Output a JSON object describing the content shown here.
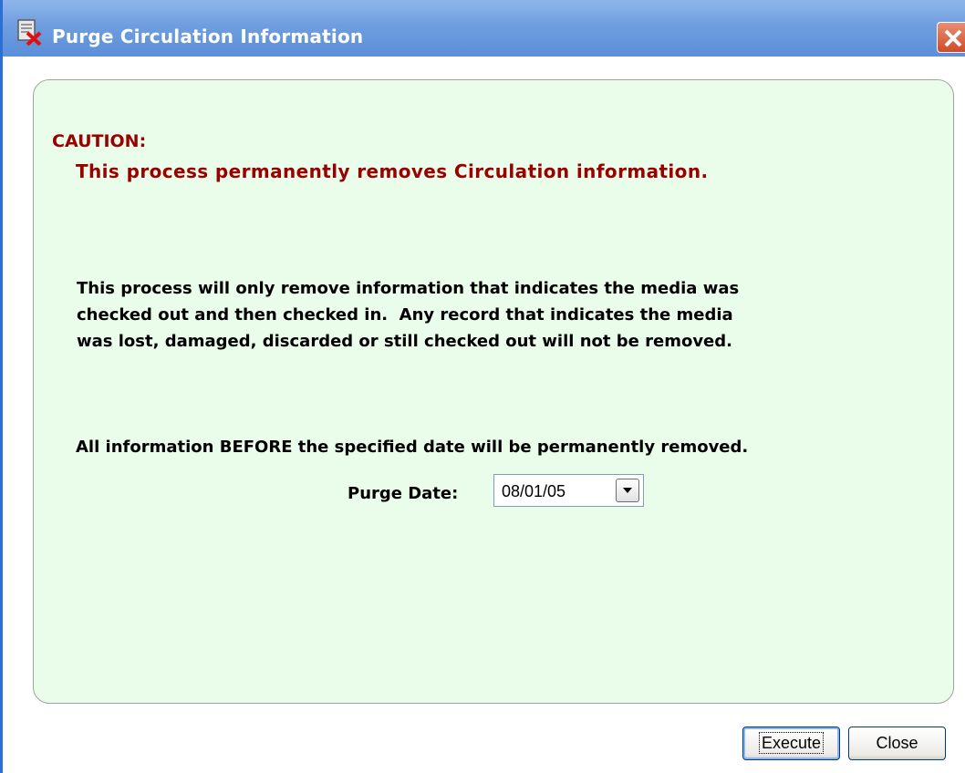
{
  "window": {
    "title": "Purge Circulation Information",
    "icons": {
      "app": "purge-document-icon",
      "close": "close-x-icon"
    }
  },
  "caution": {
    "heading": "CAUTION:",
    "message": "This process permanently removes Circulation information."
  },
  "info": {
    "lines": [
      "This process will only remove information that indicates the media was",
      "checked out and then checked in.  Any record that indicates the media",
      "was lost, damaged, discarded or still checked out will not be removed."
    ]
  },
  "before_note": "All information BEFORE the specified date will be permanently removed.",
  "purge_date": {
    "label": "Purge Date:",
    "value": "08/01/05",
    "dropdown_icon": "dropdown-arrow-icon"
  },
  "buttons": {
    "execute": "Execute",
    "close": "Close"
  },
  "colors": {
    "titlebar": "#6f9ddf",
    "panel_background": "#eafdea",
    "caution_text": "#9a0000"
  }
}
